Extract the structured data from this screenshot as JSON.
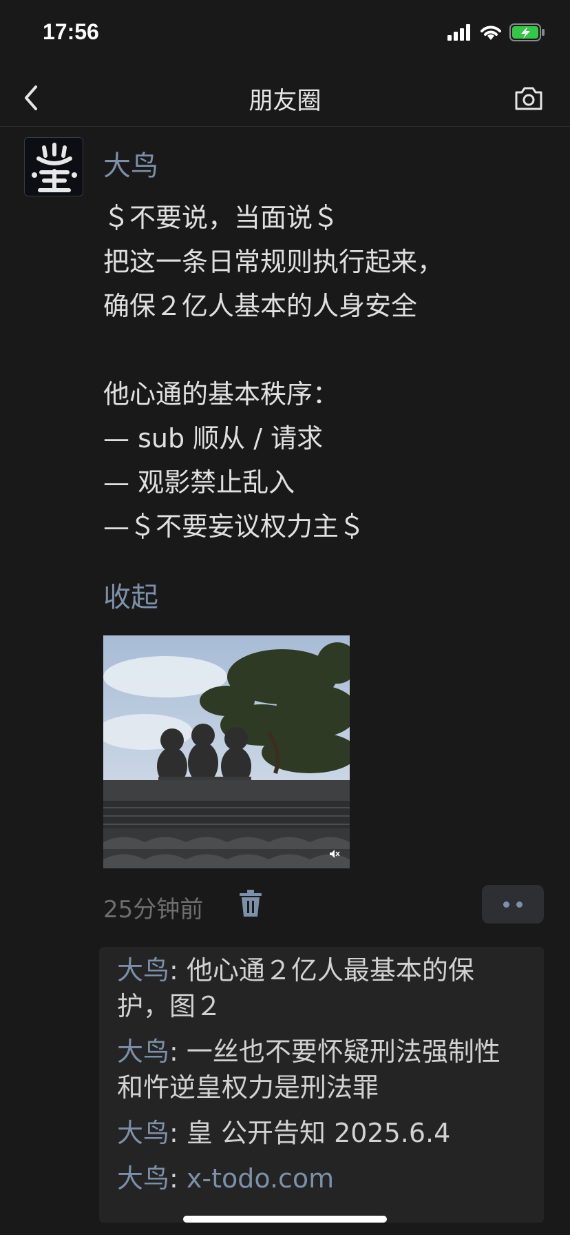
{
  "status_bar": {
    "time": "17:56",
    "icons": [
      "signal-icon",
      "wifi-icon",
      "battery-charging-icon"
    ]
  },
  "nav": {
    "title": "朋友圈",
    "back_icon": "chevron-left-icon",
    "camera_icon": "camera-icon"
  },
  "post": {
    "author": "大鸟",
    "text_lines": [
      "＄不要说，当面说＄",
      "把这一条日常规则执行起来，",
      "确保２亿人基本的人身安全",
      "",
      "他心通的基本秩序：",
      "— sub 顺从 / 请求",
      "— 观影禁止乱入",
      "—＄不要妄议权力主＄"
    ],
    "collapse_label": "收起",
    "time_ago": "25分钟前",
    "image_alt_icon": "video-mute-icon"
  },
  "comments": [
    {
      "author": "大鸟",
      "sep": ": ",
      "text": "他心通２亿人最基本的保护，图２"
    },
    {
      "author": "大鸟",
      "sep": ": ",
      "text": "一丝也不要怀疑刑法强制性和忤逆皇权力是刑法罪"
    },
    {
      "author": "大鸟",
      "sep": ": ",
      "text": "皇 公开告知 2025.6.4"
    },
    {
      "author": "大鸟",
      "sep": ": ",
      "text": "x-todo.com"
    }
  ],
  "colors": {
    "background": "#191919",
    "link_blue": "#7d90a9",
    "comment_bg": "#242424"
  }
}
